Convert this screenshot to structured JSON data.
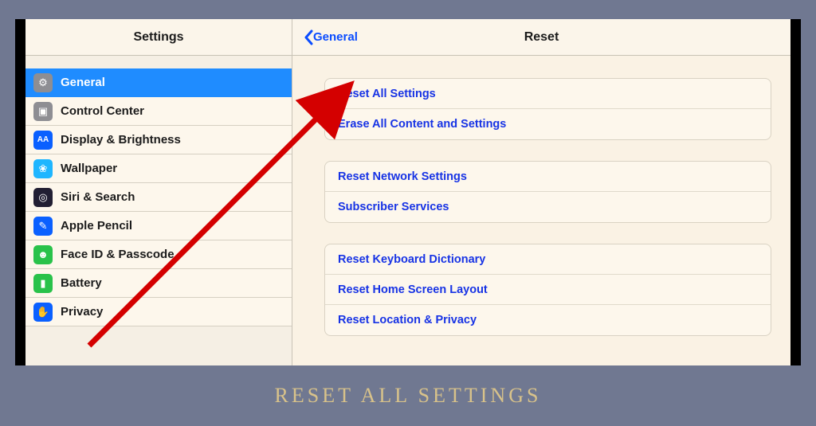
{
  "sidebar": {
    "title": "Settings",
    "items": [
      {
        "label": "General",
        "icon": "gear-icon",
        "bg": "#8e8e93",
        "glyph": "⚙",
        "selected": true
      },
      {
        "label": "Control Center",
        "icon": "sliders-icon",
        "bg": "#8e8e93",
        "glyph": "▣"
      },
      {
        "label": "Display & Brightness",
        "icon": "display-icon",
        "bg": "#0a60ff",
        "glyph": "AA"
      },
      {
        "label": "Wallpaper",
        "icon": "wallpaper-icon",
        "bg": "#1fb6ff",
        "glyph": "❀"
      },
      {
        "label": "Siri & Search",
        "icon": "siri-icon",
        "bg": "#221f33",
        "glyph": "◎"
      },
      {
        "label": "Apple Pencil",
        "icon": "pencil-icon",
        "bg": "#0a60ff",
        "glyph": "✎"
      },
      {
        "label": "Face ID & Passcode",
        "icon": "faceid-icon",
        "bg": "#29c24a",
        "glyph": "☻"
      },
      {
        "label": "Battery",
        "icon": "battery-icon",
        "bg": "#29c24a",
        "glyph": "▮"
      },
      {
        "label": "Privacy",
        "icon": "privacy-icon",
        "bg": "#0a60ff",
        "glyph": "✋"
      }
    ]
  },
  "detail": {
    "back_label": "General",
    "title": "Reset",
    "groups": [
      [
        "Reset All Settings",
        "Erase All Content and Settings"
      ],
      [
        "Reset Network Settings",
        "Subscriber Services"
      ],
      [
        "Reset Keyboard Dictionary",
        "Reset Home Screen Layout",
        "Reset Location & Privacy"
      ]
    ]
  },
  "caption": "RESET ALL SETTINGS",
  "annotation": {
    "type": "arrow",
    "target": "Reset All Settings",
    "color": "#d40000"
  }
}
